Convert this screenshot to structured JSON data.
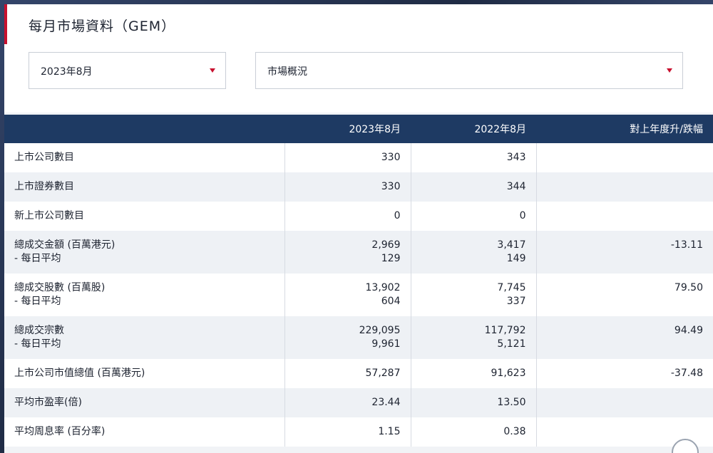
{
  "title": "每月市場資料（GEM）",
  "filters": {
    "month": "2023年8月",
    "category": "市場概況"
  },
  "table": {
    "headers": [
      "",
      "2023年8月",
      "2022年8月",
      "對上年度升/跌幅"
    ],
    "rows": [
      {
        "label": "上市公司數目",
        "sub_label": "",
        "cur": "330",
        "cur_sub": "",
        "prev": "343",
        "prev_sub": "",
        "change": ""
      },
      {
        "label": "上市證券數目",
        "sub_label": "",
        "cur": "330",
        "cur_sub": "",
        "prev": "344",
        "prev_sub": "",
        "change": ""
      },
      {
        "label": "新上市公司數目",
        "sub_label": "",
        "cur": "0",
        "cur_sub": "",
        "prev": "0",
        "prev_sub": "",
        "change": ""
      },
      {
        "label": "總成交金額 (百萬港元)",
        "sub_label": "- 每日平均",
        "cur": "2,969",
        "cur_sub": "129",
        "prev": "3,417",
        "prev_sub": "149",
        "change": "-13.11"
      },
      {
        "label": "總成交股數 (百萬股)",
        "sub_label": "- 每日平均",
        "cur": "13,902",
        "cur_sub": "604",
        "prev": "7,745",
        "prev_sub": "337",
        "change": "79.50"
      },
      {
        "label": "總成交宗數",
        "sub_label": "- 每日平均",
        "cur": "229,095",
        "cur_sub": "9,961",
        "prev": "117,792",
        "prev_sub": "5,121",
        "change": "94.49"
      },
      {
        "label": "上市公司市值總值 (百萬港元)",
        "sub_label": "",
        "cur": "57,287",
        "cur_sub": "",
        "prev": "91,623",
        "prev_sub": "",
        "change": "-37.48"
      },
      {
        "label": "平均市盈率(倍)",
        "sub_label": "",
        "cur": "23.44",
        "cur_sub": "",
        "prev": "13.50",
        "prev_sub": "",
        "change": ""
      },
      {
        "label": "平均周息率 (百分率)",
        "sub_label": "",
        "cur": "1.15",
        "cur_sub": "",
        "prev": "0.38",
        "prev_sub": "",
        "change": ""
      }
    ]
  },
  "colors": {
    "accent": "#c8102e",
    "header_bg": "#1e3a63"
  }
}
